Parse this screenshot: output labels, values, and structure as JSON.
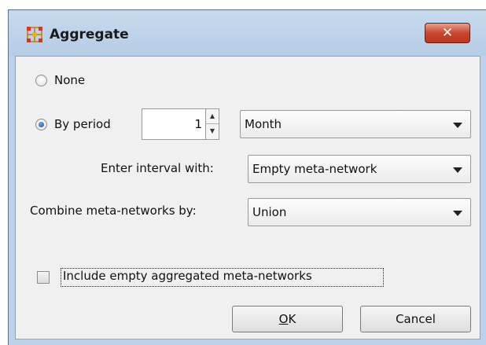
{
  "window": {
    "title": "Aggregate",
    "close_glyph": "✕",
    "icon": "network-icon"
  },
  "options": {
    "none_label": "None",
    "by_period_label": "By period",
    "selected": "by_period",
    "period_value": "1",
    "period_unit": "Month",
    "interval_label": "Enter interval with:",
    "interval_value": "Empty meta-network",
    "combine_label": "Combine meta-networks by:",
    "combine_value": "Union",
    "include_empty_label": "Include empty aggregated meta-networks",
    "include_empty_checked": false
  },
  "buttons": {
    "ok_mnemonic": "O",
    "ok_rest": "K",
    "cancel": "Cancel"
  },
  "colors": {
    "frame": "#bcd2ea",
    "close_button": "#c9462f",
    "radio_selected": "#1a4f9c"
  }
}
